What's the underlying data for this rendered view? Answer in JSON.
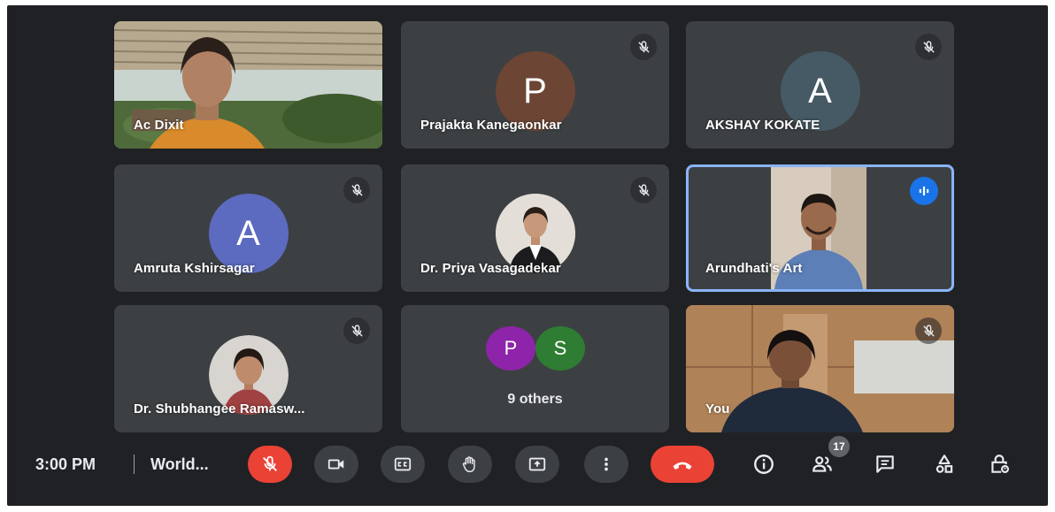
{
  "participants": [
    {
      "name": "Ac Dixit"
    },
    {
      "name": "Prajakta Kanegaonkar",
      "initial": "P",
      "avatar_color": "#6d4535"
    },
    {
      "name": "AKSHAY KOKATE",
      "initial": "A",
      "avatar_color": "#455a64"
    },
    {
      "name": "Amruta Kshirsagar",
      "initial": "A",
      "avatar_color": "#5c6bc0"
    },
    {
      "name": "Dr. Priya Vasagadekar"
    },
    {
      "name": "Arundhati's Art"
    },
    {
      "name": "Dr. Shubhangee Ramasw..."
    },
    {
      "name": "You"
    }
  ],
  "others_tile": {
    "initials": [
      "P",
      "S"
    ],
    "colors": [
      "#8e24aa",
      "#2e7d32"
    ],
    "label": "9 others"
  },
  "toolbar": {
    "time": "3:00 PM",
    "separator": "|",
    "meeting_title": "World...",
    "people_count": "17"
  },
  "colors": {
    "background": "#202124",
    "tile": "#3c4043",
    "active_border": "#8ab4f8",
    "hangup": "#ea4335",
    "speaking": "#1a73e8"
  }
}
